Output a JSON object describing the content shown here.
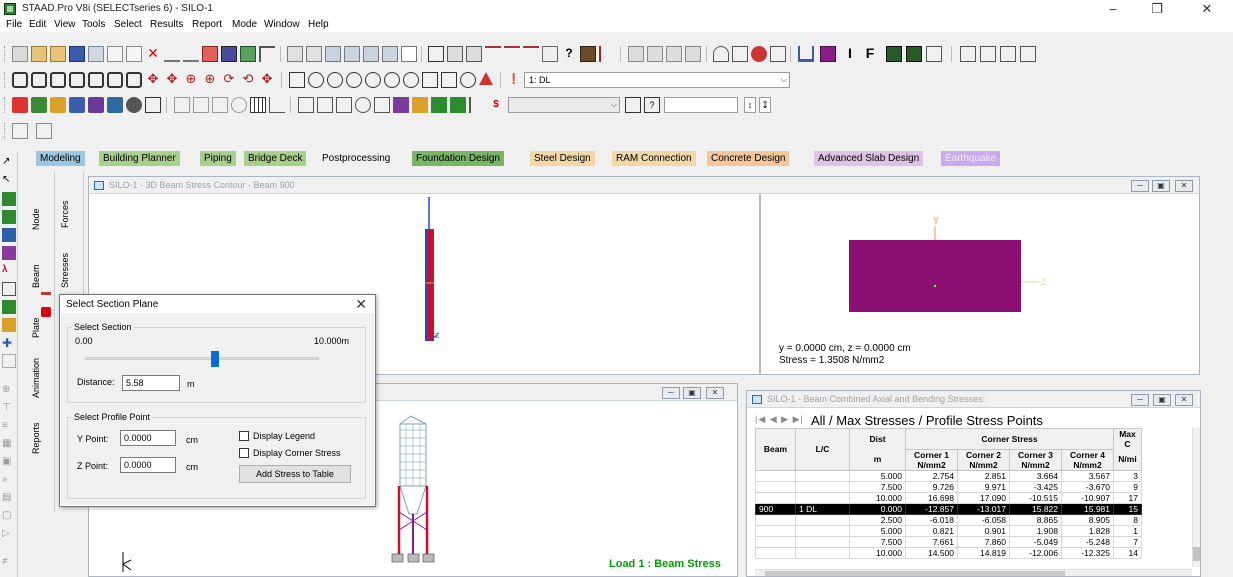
{
  "window": {
    "title": "STAAD.Pro V8i (SELECTseries 6) - SILO-1"
  },
  "menu": [
    "File",
    "Edit",
    "View",
    "Tools",
    "Select",
    "Results",
    "Report",
    "Mode",
    "Window",
    "Help"
  ],
  "toolbar": {
    "load_case": "1: DL"
  },
  "mode_tabs": [
    {
      "label": "Modeling",
      "color": "#9dc7e0"
    },
    {
      "label": "Building Planner",
      "color": "#a8d08d"
    },
    {
      "label": "Piping",
      "color": "#a8d08d"
    },
    {
      "label": "Bridge Deck",
      "color": "#a8d08d"
    },
    {
      "label": "Postprocessing",
      "color": "#f0f0f0"
    },
    {
      "label": "Foundation Design",
      "color": "#79b563"
    },
    {
      "label": "Steel Design",
      "color": "#f3d7a7"
    },
    {
      "label": "RAM Connection",
      "color": "#f3d7a7"
    },
    {
      "label": "Concrete Design",
      "color": "#f3c79b"
    },
    {
      "label": "Advanced Slab Design",
      "color": "#ddc4e6"
    },
    {
      "label": "Earthquake",
      "color": "#c9a9f0"
    }
  ],
  "vtabs": {
    "page": [
      "Node",
      "Beam",
      "Plate",
      "Animation",
      "Reports"
    ],
    "sub": [
      "Forces",
      "Stresses"
    ]
  },
  "window_3d": {
    "title": "SILO-1 - 3D Beam Stress Contour - Beam 900",
    "readout_line1": "y = 0.0000 cm, z = 0.0000 cm",
    "readout_line2": "Stress = 1.3508 N/mm2",
    "axis_y": "Y",
    "axis_z": "Z"
  },
  "window_main": {
    "load_label": "Load 1 : Beam Stress"
  },
  "window_table": {
    "title": "SILO-1 - Beam Combined Axial and Bending Stresses:",
    "tabs": "All / Max Stresses / Profile Stress Points",
    "group_header": "Corner Stress",
    "columns": [
      {
        "h1": "Beam",
        "h2": ""
      },
      {
        "h1": "L/C",
        "h2": ""
      },
      {
        "h1": "Dist",
        "h2": "m"
      },
      {
        "h1": "Corner 1",
        "h2": "N/mm2"
      },
      {
        "h1": "Corner 2",
        "h2": "N/mm2"
      },
      {
        "h1": "Corner 3",
        "h2": "N/mm2"
      },
      {
        "h1": "Corner 4",
        "h2": "N/mm2"
      },
      {
        "h1": "Max C",
        "h2": "N/mi"
      }
    ],
    "rows": [
      {
        "beam": "",
        "lc": "",
        "dist": "5.000",
        "c1": "2.754",
        "c2": "2.851",
        "c3": "3.664",
        "c4": "3.567",
        "max": "3",
        "selected": false
      },
      {
        "beam": "",
        "lc": "",
        "dist": "7.500",
        "c1": "9.726",
        "c2": "9.971",
        "c3": "-3.425",
        "c4": "-3.670",
        "max": "9",
        "selected": false
      },
      {
        "beam": "",
        "lc": "",
        "dist": "10.000",
        "c1": "16.698",
        "c2": "17.090",
        "c3": "-10.515",
        "c4": "-10.907",
        "max": "17",
        "selected": false
      },
      {
        "beam": "900",
        "lc": "1 DL",
        "dist": "0.000",
        "c1": "-12.857",
        "c2": "-13.017",
        "c3": "15.822",
        "c4": "15.981",
        "max": "15",
        "selected": true
      },
      {
        "beam": "",
        "lc": "",
        "dist": "2.500",
        "c1": "-6.018",
        "c2": "-6.058",
        "c3": "8.865",
        "c4": "8.905",
        "max": "8",
        "selected": false
      },
      {
        "beam": "",
        "lc": "",
        "dist": "5.000",
        "c1": "0.821",
        "c2": "0.901",
        "c3": "1.908",
        "c4": "1.828",
        "max": "1",
        "selected": false
      },
      {
        "beam": "",
        "lc": "",
        "dist": "7.500",
        "c1": "7.661",
        "c2": "7.860",
        "c3": "-5.049",
        "c4": "-5.248",
        "max": "7",
        "selected": false
      },
      {
        "beam": "",
        "lc": "",
        "dist": "10.000",
        "c1": "14.500",
        "c2": "14.819",
        "c3": "-12.006",
        "c4": "-12.325",
        "max": "14",
        "selected": false
      }
    ]
  },
  "dialog": {
    "title": "Select Section Plane",
    "section_group": "Select Section",
    "min_label": "0.00",
    "max_label": "10.000m",
    "slider_fraction": 0.558,
    "distance_label": "Distance:",
    "distance_value": "5.58",
    "distance_unit": "m",
    "profile_group": "Select Profile Point",
    "y_label": "Y Point:",
    "y_value": "0.0000",
    "z_label": "Z Point:",
    "z_value": "0.0000",
    "unit_cm": "cm",
    "chk_legend": "Display Legend",
    "chk_corner": "Display Corner Stress",
    "add_button": "Add Stress to Table"
  },
  "colors": {
    "section_fill": "#8b0f72",
    "beam_red": "#c8102e",
    "beam_blue": "#2a45c8",
    "selected_row": "#000000",
    "load_label": "#00a000"
  }
}
